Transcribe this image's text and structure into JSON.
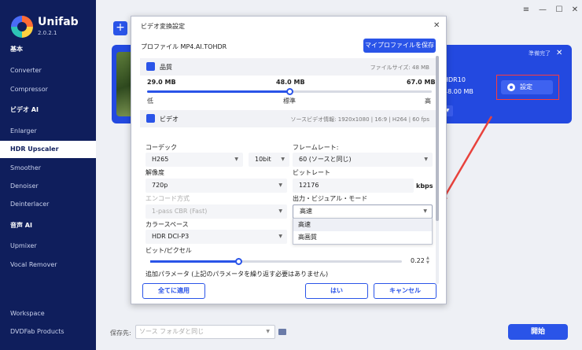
{
  "app": {
    "brand": "Unifab",
    "version": "2.0.2.1"
  },
  "sidebar": {
    "items": [
      {
        "label": "基本",
        "type": "head"
      },
      {
        "label": "Converter",
        "type": "item"
      },
      {
        "label": "Compressor",
        "type": "item"
      },
      {
        "label": "ビデオ AI",
        "type": "head"
      },
      {
        "label": "Enlarger",
        "type": "item"
      },
      {
        "label": "HDR Upscaler",
        "type": "active"
      },
      {
        "label": "Smoother",
        "type": "item"
      },
      {
        "label": "Denoiser",
        "type": "item"
      },
      {
        "label": "Deinterlacer",
        "type": "item"
      },
      {
        "label": "音声 AI",
        "type": "head"
      },
      {
        "label": "Upmixer",
        "type": "item"
      },
      {
        "label": "Vocal Remover",
        "type": "item"
      },
      {
        "label": "Workspace",
        "type": "item"
      },
      {
        "label": "DVDFab Products",
        "type": "item"
      }
    ]
  },
  "window_controls": {
    "menu": "≡",
    "minimize": "—",
    "maximize": "☐",
    "close": "✕"
  },
  "task": {
    "add": "+",
    "ready": "準備完了",
    "close": "✕",
    "hdr": "HDR10",
    "size": "48.00 MB",
    "settings_label": "設定"
  },
  "footer": {
    "save_label": "保存先:",
    "save_placeholder": "ソース フォルダと同じ",
    "start_label": "開始"
  },
  "dialog": {
    "title": "ビデオ変換設定",
    "close": "✕",
    "profile_label": "プロファイル MP4.AI.TOHDR",
    "save_profile_button": "マイプロファイルを保存",
    "quality": {
      "title": "品質",
      "file_size": "ファイルサイズ: 48 MB",
      "min_size": "29.0 MB",
      "mid_size": "48.0 MB",
      "max_size": "67.0 MB",
      "low": "低",
      "standard": "標準",
      "high": "高",
      "position": 0.5
    },
    "video": {
      "title": "ビデオ",
      "source_info": "ソースビデオ情報: 1920x1080 | 16:9 | H264 | 60 fps",
      "codec_label": "コーデック",
      "codec_value": "H265",
      "bitdepth_value": "10bit",
      "framerate_label": "フレームレート:",
      "framerate_value": "60 (ソースと同じ)",
      "resolution_label": "解像度",
      "resolution_value": "720p",
      "bitrate_label": "ビットレート",
      "bitrate_value": "12176",
      "bitrate_unit": "kbps",
      "encode_label": "エンコード方式",
      "encode_value": "1-pass CBR (Fast)",
      "visual_mode_label": "出力・ビジュアル・モード",
      "visual_mode_value": "高速",
      "visual_mode_options": [
        "高速",
        "高画質"
      ],
      "colorspace_label": "カラースペース",
      "colorspace_value": "HDR DCI-P3",
      "bpp_label": "ビット/ピクセル",
      "bpp_value": "0.22",
      "bpp_position": 0.35,
      "extra_note": "追加パラメータ (上記のパラメータを繰り返す必要はありません)"
    },
    "apply_all_button": "全てに適用",
    "ok_button": "はい",
    "cancel_button": "キャンセル"
  },
  "colors": {
    "accent": "#2a54e8",
    "sidebar": "#0f1e5c",
    "highlight": "#ff3b3b"
  }
}
